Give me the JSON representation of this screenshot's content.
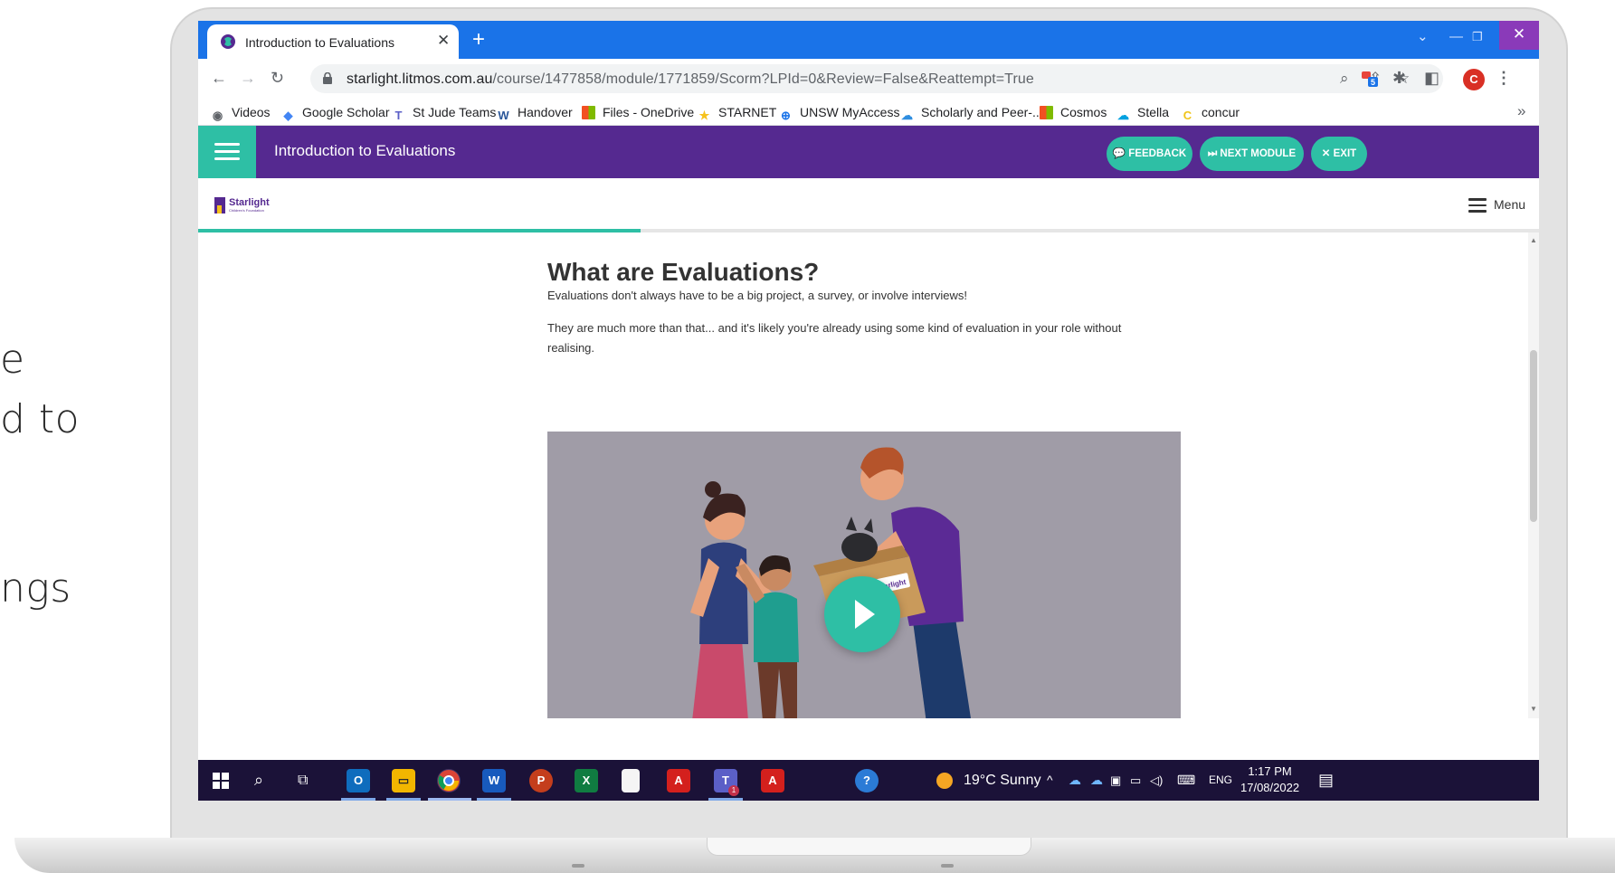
{
  "slide_fragments": [
    "e",
    "d to",
    "ngs"
  ],
  "browser": {
    "tab_title": "Introduction to Evaluations",
    "new_tab_symbol": "+",
    "url_host": "starlight.litmos.com.au",
    "url_path": "/course/1477858/module/1771859/Scorm?LPId=0&Review=False&Reattempt=True",
    "profile_initial": "C",
    "extension_badge": "5",
    "bookmarks": [
      {
        "label": "Videos",
        "icon": "globe-icon",
        "color": "#5f6368"
      },
      {
        "label": "Google Scholar",
        "icon": "scholar-icon",
        "color": "#4285f4"
      },
      {
        "label": "St Jude Teams",
        "icon": "teams-icon",
        "color": "#5b5fc7"
      },
      {
        "label": "Handover",
        "icon": "word-icon",
        "color": "#2b579a"
      },
      {
        "label": "Files - OneDrive",
        "icon": "microsoft-icon",
        "color": "#f25022"
      },
      {
        "label": "STARNET",
        "icon": "star-icon",
        "color": "#f6c21c"
      },
      {
        "label": "UNSW MyAccess",
        "icon": "lock-icon",
        "color": "#1a73e8"
      },
      {
        "label": "Scholarly and Peer-...",
        "icon": "cloud-icon",
        "color": "#2f8ee0"
      },
      {
        "label": "Cosmos",
        "icon": "microsoft-icon",
        "color": "#f25022"
      },
      {
        "label": "Stella",
        "icon": "salesforce-icon",
        "color": "#00a1e0"
      },
      {
        "label": "concur",
        "icon": "concur-icon",
        "color": "#f0c419"
      }
    ],
    "bookmarks_overflow": "»"
  },
  "course": {
    "title": "Introduction to Evaluations",
    "buttons": {
      "feedback": "💬 FEEDBACK",
      "next_module": "⏭ NEXT MODULE",
      "exit": "✕ EXIT"
    },
    "logo_text": "Starlight",
    "logo_subtext": "Children's Foundation",
    "menu_label": "Menu",
    "progress_fraction": 0.33
  },
  "content": {
    "heading": "What are Evaluations?",
    "paragraph1": "Evaluations don't always have to be a big project, a survey, or involve interviews!",
    "paragraph2_line1": "They are much more than that... and it's likely you're already using some kind of evaluation in your role without",
    "paragraph2_line2": "realising.",
    "video_box_label": "Starlight"
  },
  "taskbar": {
    "weather": "19°C  Sunny",
    "language": "ENG",
    "time": "1:17 PM",
    "date": "17/08/2022",
    "teams_badge": "1"
  },
  "colors": {
    "purple": "#552990",
    "teal": "#2ebfa5",
    "chrome_blue": "#1a73e8"
  }
}
